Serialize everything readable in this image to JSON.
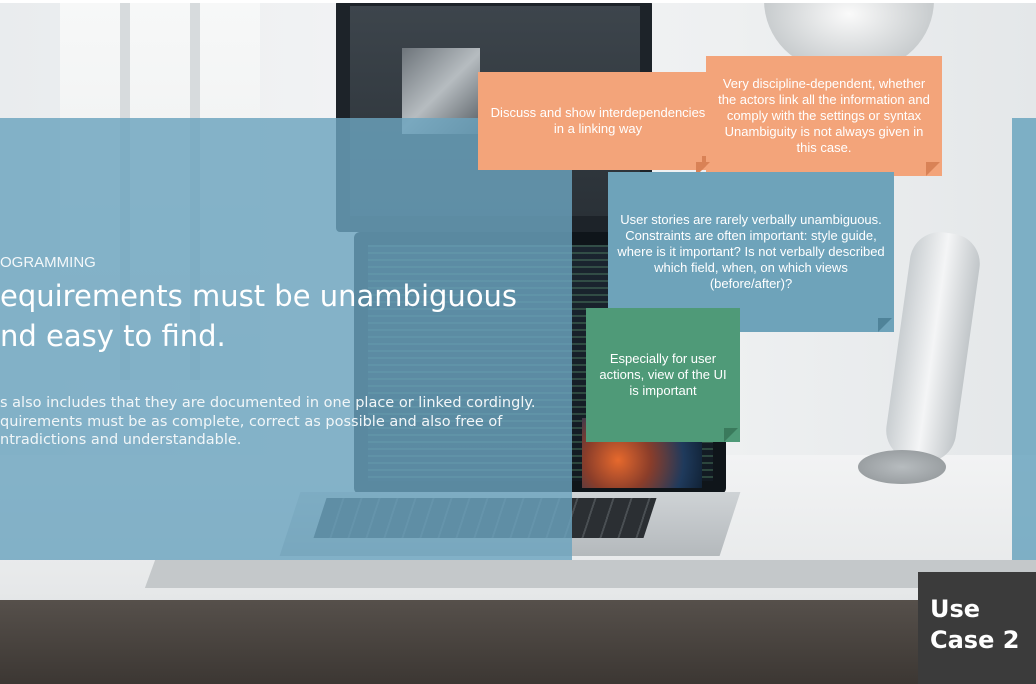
{
  "slide": {
    "kicker": "OGRAMMING",
    "headline": "equirements must be unambiguous nd easy to find.",
    "body": [
      "s also includes that they are documented in one place or linked cordingly.",
      "quirements must be as complete, correct as possible and also free of ntradictions and understandable."
    ]
  },
  "notes": {
    "orange_a": "Discuss and show interdependencies in a linking way",
    "orange_b": "Very discipline-dependent, whether the actors link all the information and comply with the settings or syntax Unambiguity is not always given in this case.",
    "blue": "User stories are rarely verbally unambiguous. Constraints are often important: style guide, where is it important? Is not verbally described which field, when, on which views (before/after)?",
    "green": "Especially for user actions, view of the UI is important"
  },
  "badge": {
    "line1": "Use",
    "line2": "Case 2"
  },
  "colors": {
    "panel": "#6ba4be",
    "note_orange": "#f3a47a",
    "note_blue": "#6ea3ba",
    "note_green": "#4f9a78",
    "badge": "#3b3b3b"
  }
}
